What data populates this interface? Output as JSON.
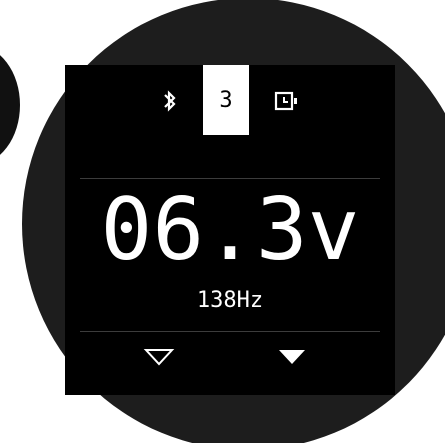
{
  "device": {
    "profile_number": "3",
    "voltage_display": "06.3v",
    "frequency_display": "138Hz",
    "icons": {
      "left_status": "bluetooth-icon",
      "right_status": "timer-icon",
      "decrease": "down-outline-triangle-icon",
      "increase": "down-filled-triangle-icon"
    },
    "colors": {
      "screen_bg": "#000000",
      "text": "#ffffff",
      "bezel": "#1d1d1d",
      "chip_bg": "#ffffff"
    }
  }
}
